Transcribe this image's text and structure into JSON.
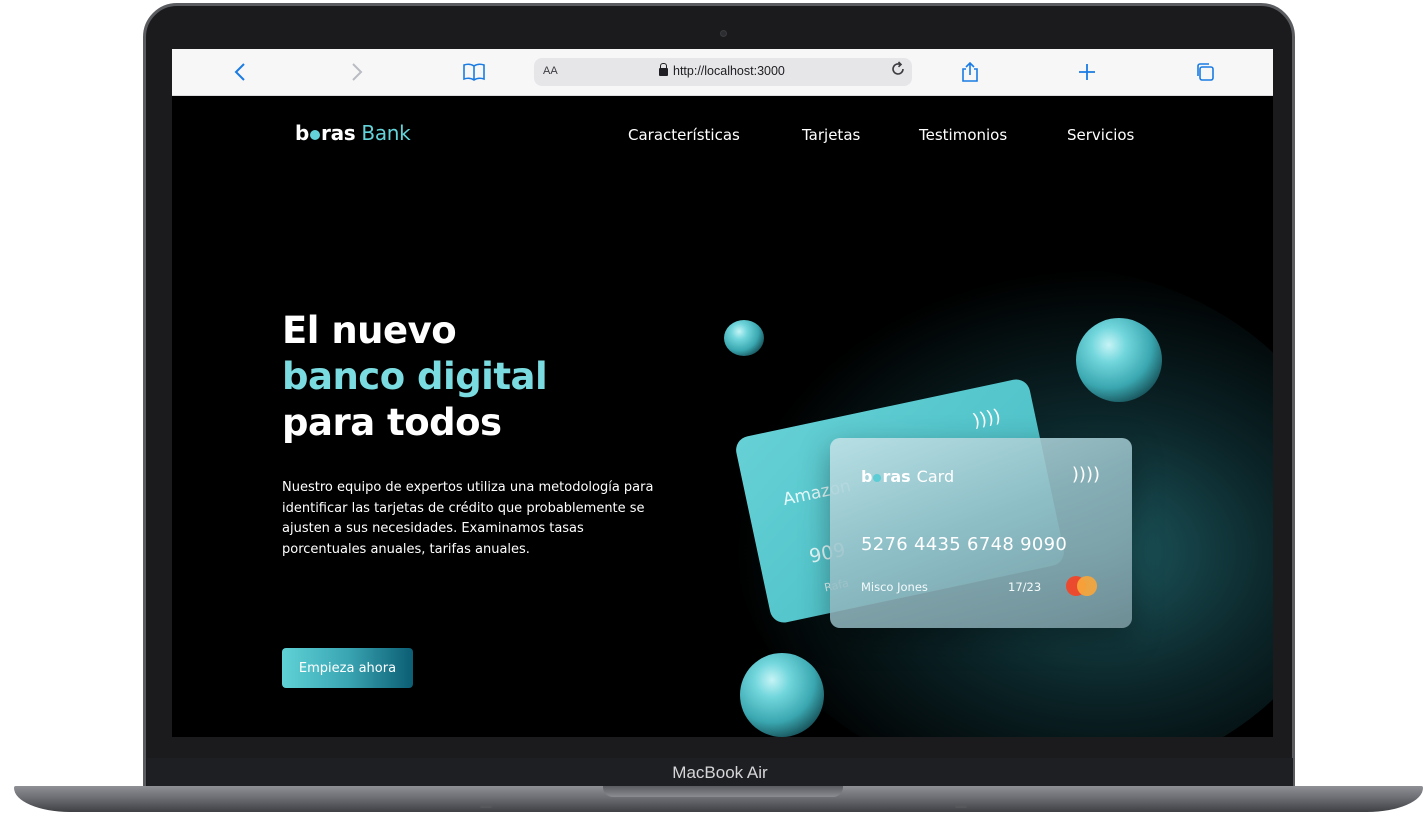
{
  "device": {
    "model_label": "MacBook Air"
  },
  "browser": {
    "text_size_label": "AA",
    "url": "http://localhost:3000",
    "icons": [
      "back-icon",
      "forward-icon",
      "bookmarks-icon",
      "lock-icon",
      "reload-icon",
      "share-icon",
      "new-tab-icon",
      "tabs-icon"
    ]
  },
  "site": {
    "logo": {
      "part1_before_dot": "b",
      "part1_after_dot": "ras",
      "part2": "Bank"
    },
    "nav": [
      "Características",
      "Tarjetas",
      "Testimonios",
      "Servicios"
    ],
    "hero": {
      "line1": "El nuevo",
      "line2": "banco digital",
      "line3": "para todos",
      "description": "Nuestro equipo de expertos utiliza una metodología para identificar las tarjetas de crédito que probablemente se ajusten a sus necesidades. Examinamos tasas porcentuales anuales, tarifas anuales.",
      "cta_label": "Empieza ahora"
    },
    "card_back": {
      "brand": "Amazon",
      "number_fragment": "909",
      "holder_fragment": "Rafa"
    },
    "card_front": {
      "logo_before_dot": "b",
      "logo_after_dot": "ras",
      "logo_suffix": "Card",
      "number": "5276 4435 6748 9090",
      "holder": "Misco Jones",
      "expiry": "17/23"
    },
    "colors": {
      "accent": "#63d3d9",
      "background": "#000000",
      "cta_start": "#5fd2d6",
      "cta_end": "#0b5d74"
    }
  }
}
